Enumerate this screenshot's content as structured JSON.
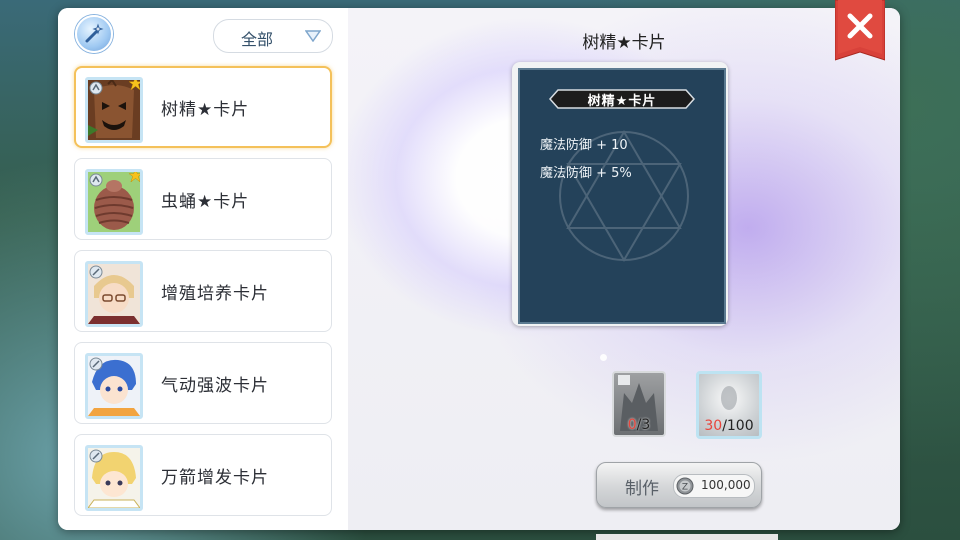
{
  "filter": {
    "label": "全部"
  },
  "card_list": [
    {
      "name": "树精★卡片",
      "selected": true
    },
    {
      "name": "虫蛹★卡片",
      "selected": false
    },
    {
      "name": "增殖培养卡片",
      "selected": false
    },
    {
      "name": "气动强波卡片",
      "selected": false
    },
    {
      "name": "万箭增发卡片",
      "selected": false
    }
  ],
  "detail": {
    "title": "树精★卡片",
    "banner": "树精★卡片",
    "stats": [
      "魔法防御 + 10",
      "魔法防御 + 5%"
    ]
  },
  "materials": [
    {
      "have": "0",
      "need": "/3"
    },
    {
      "have": "30",
      "need": "/100"
    }
  ],
  "craft": {
    "label": "制作",
    "cost": "100,000"
  },
  "colors": {
    "selected_border": "#f4c15a",
    "close_red": "#e8453c",
    "card_bg": "#24425a"
  }
}
